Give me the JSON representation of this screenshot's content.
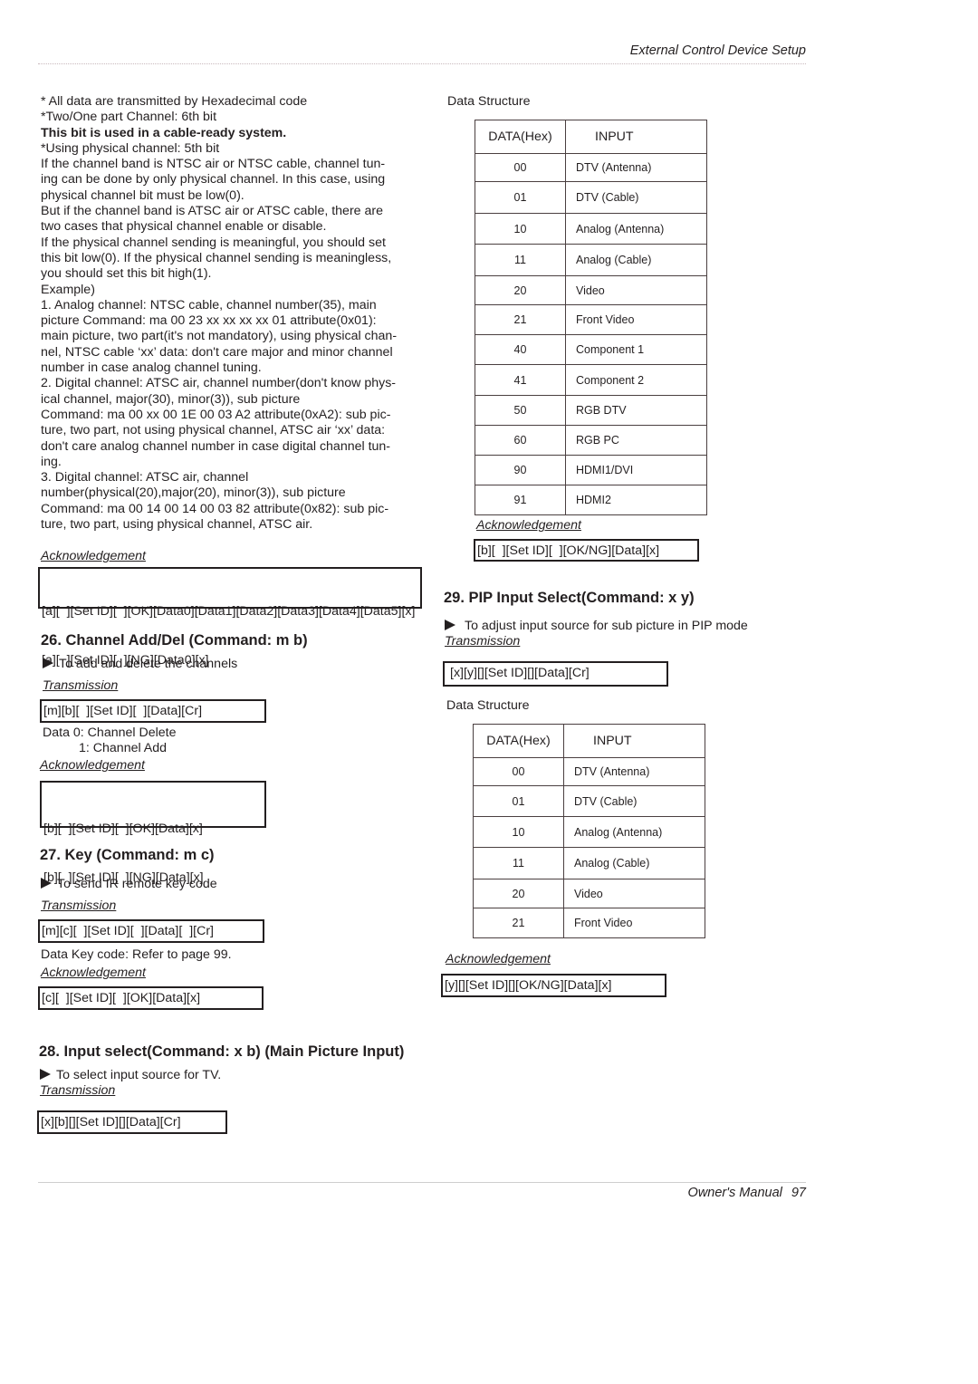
{
  "header": {
    "title": "External Control Device Setup"
  },
  "footer": {
    "label": "Owner's Manual",
    "page": "97"
  },
  "intro": {
    "line1": "* All data are transmitted by Hexadecimal code",
    "line2": "*Two/One part Channel: 6th bit",
    "line3_bold": "This bit is used in a cable-ready system.",
    "line4": "*Using physical channel: 5th bit",
    "lines": [
      "If the channel band is NTSC air or NTSC cable, channel tun-",
      "ing can be done by only physical channel. In this case, using",
      "physical channel bit must be low(0).",
      "But if the channel band is ATSC air or ATSC cable, there are",
      "two cases that physical channel enable or disable.",
      "If the physical channel sending is meaningful, you should set",
      "this bit low(0). If the physical channel sending is meaningless,",
      "you should set this bit high(1).",
      "Example)",
      "1. Analog channel: NTSC cable, channel number(35), main",
      "picture Command: ma 00 23 xx xx xx xx 01 attribute(0x01):",
      "main picture, two part(it's not mandatory), using physical chan-",
      "nel, NTSC cable ‘xx’ data: don't care major and minor channel",
      "number in case analog channel tuning.",
      "2. Digital channel: ATSC air, channel number(don't know phys-",
      "ical channel, major(30), minor(3)), sub picture",
      "Command: ma 00 xx 00 1E 00 03 A2 attribute(0xA2): sub pic-",
      "ture, two part, not using physical channel, ATSC air ‘xx’ data:",
      "don't care analog channel number in case digital channel tun-",
      "ing.",
      "3. Digital channel: ATSC air, channel",
      "number(physical(20),major(20), minor(3)), sub picture",
      "Command: ma 00 14 00 14 00 03 82 attribute(0x82): sub pic-",
      "ture, two part, using physical channel, ATSC air."
    ],
    "ack_label": "Acknowledgement",
    "ack_lines": [
      "[a][  ][Set ID][  ][OK][Data0][Data1][Data2][Data3][Data4][Data5][x]",
      "[a][  ][Set ID][  ][NG][Data0][x]"
    ]
  },
  "sec26": {
    "title": "26. Channel Add/Del (Command: m b)",
    "desc": "To add and delete the channels",
    "tx_label": "Transmission",
    "tx": "[m][b][  ][Set ID][  ][Data][Cr]",
    "data_line1": "Data  0: Channel Delete",
    "data_line2": "1: Channel Add",
    "ack_label": "Acknowledgement",
    "ack_lines": [
      "[b][  ][Set ID][  ][OK][Data][x]",
      "[b][  ][Set ID][  ][NG][Data][x]"
    ]
  },
  "sec27": {
    "title": "27. Key (Command: m c)",
    "desc": "To send IR remote key code",
    "tx_label": "Transmission",
    "tx": "[m][c][  ][Set ID][  ][Data][  ][Cr]",
    "data_line": "Data  Key code: Refer to page 99.",
    "ack_label": "Acknowledgement",
    "ack": "[c][  ][Set ID][  ][OK][Data][x]"
  },
  "sec28": {
    "title": "28. Input select(Command: x b) (Main Picture Input)",
    "desc": "To select input source for TV.",
    "tx_label": "Transmission",
    "tx": "[x][b][][Set ID][][Data][Cr]",
    "ds_label": "Data Structure",
    "table_head": [
      "DATA(Hex)",
      "INPUT"
    ],
    "rows": [
      {
        "hex": "00",
        "input": "DTV (Antenna)"
      },
      {
        "hex": "01",
        "input": "DTV (Cable)"
      },
      {
        "hex": "10",
        "input": "Analog (Antenna)"
      },
      {
        "hex": "11",
        "input": "Analog (Cable)"
      },
      {
        "hex": "20",
        "input": "Video"
      },
      {
        "hex": "21",
        "input": "Front Video"
      },
      {
        "hex": "40",
        "input": "Component 1"
      },
      {
        "hex": "41",
        "input": "Component 2"
      },
      {
        "hex": "50",
        "input": "RGB DTV"
      },
      {
        "hex": "60",
        "input": "RGB PC"
      },
      {
        "hex": "90",
        "input": "HDMI1/DVI"
      },
      {
        "hex": "91",
        "input": "HDMI2"
      }
    ],
    "ack_label": "Acknowledgement",
    "ack": "[b][  ][Set ID][  ][OK/NG][Data][x]"
  },
  "sec29": {
    "title": "29. PIP Input Select(Command: x y)",
    "desc": "To adjust input source for sub picture in PIP mode",
    "tx_label": "Transmission",
    "tx": "[x][y][][Set ID][][Data][Cr]",
    "ds_label": "Data Structure",
    "table_head": [
      "DATA(Hex)",
      "INPUT"
    ],
    "rows": [
      {
        "hex": "00",
        "input": "DTV (Antenna)"
      },
      {
        "hex": "01",
        "input": "DTV (Cable)"
      },
      {
        "hex": "10",
        "input": "Analog (Antenna)"
      },
      {
        "hex": "11",
        "input": "Analog (Cable)"
      },
      {
        "hex": "20",
        "input": "Video"
      },
      {
        "hex": "21",
        "input": "Front Video"
      }
    ],
    "ack_label": "Acknowledgement",
    "ack": "[y][][Set ID][][OK/NG][Data][x]"
  }
}
